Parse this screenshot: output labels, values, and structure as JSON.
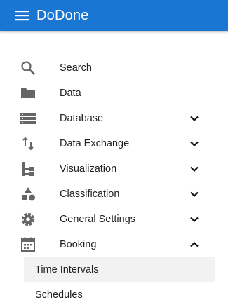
{
  "app": {
    "title": "DoDone",
    "accent_color": "#1976d2",
    "menu_icon": "hamburger-menu-icon"
  },
  "nav": {
    "items": [
      {
        "label": "Search",
        "icon": "search-icon",
        "expandable": false
      },
      {
        "label": "Data",
        "icon": "folder-icon",
        "expandable": false
      },
      {
        "label": "Database",
        "icon": "database-list-icon",
        "expandable": true,
        "expanded": false
      },
      {
        "label": "Data Exchange",
        "icon": "swap-vertical-icon",
        "expandable": true,
        "expanded": false
      },
      {
        "label": "Visualization",
        "icon": "tree-structure-icon",
        "expandable": true,
        "expanded": false
      },
      {
        "label": "Classification",
        "icon": "shapes-icon",
        "expandable": true,
        "expanded": false
      },
      {
        "label": "General Settings",
        "icon": "gear-icon",
        "expandable": true,
        "expanded": false
      },
      {
        "label": "Booking",
        "icon": "calendar-icon",
        "expandable": true,
        "expanded": true
      }
    ]
  },
  "booking_submenu": {
    "items": [
      {
        "label": "Time Intervals",
        "selected": true
      },
      {
        "label": "Schedules",
        "selected": false
      }
    ]
  }
}
